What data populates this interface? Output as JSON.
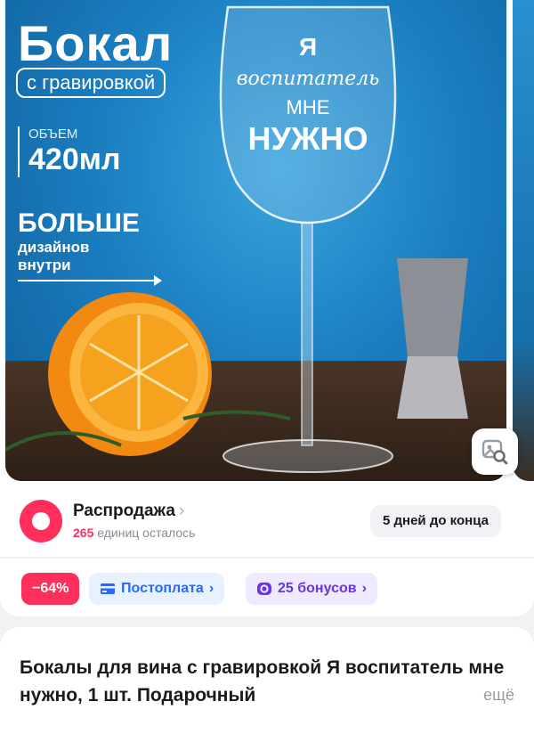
{
  "photo": {
    "title": "Бокал",
    "engraving_label": "с гравировкой",
    "volume_label": "ОБЪЕМ",
    "volume_value": "420мл",
    "more_line1": "БОЛЬШЕ",
    "more_line2": "дизайнов",
    "more_line3": "внутри",
    "engraving_words": [
      "Я",
      "воспитатель",
      "МНЕ",
      "НУЖНО"
    ],
    "search_icon": "image-search-icon"
  },
  "sale": {
    "title": "Распродажа",
    "count": "265",
    "remaining_text": "единиц осталось",
    "days_left": "5 дней до конца"
  },
  "chips": {
    "discount": "−64%",
    "postpay": "Постоплата",
    "bonus": "25 бонусов"
  },
  "product": {
    "title": "Бокалы для вина с гравировкой Я воспитатель мне нужно, 1 шт. Подарочный",
    "more": "ещё"
  },
  "colors": {
    "accent": "#ff2e5b",
    "postpay": "#2569ff",
    "bonus": "#6b34e8"
  }
}
